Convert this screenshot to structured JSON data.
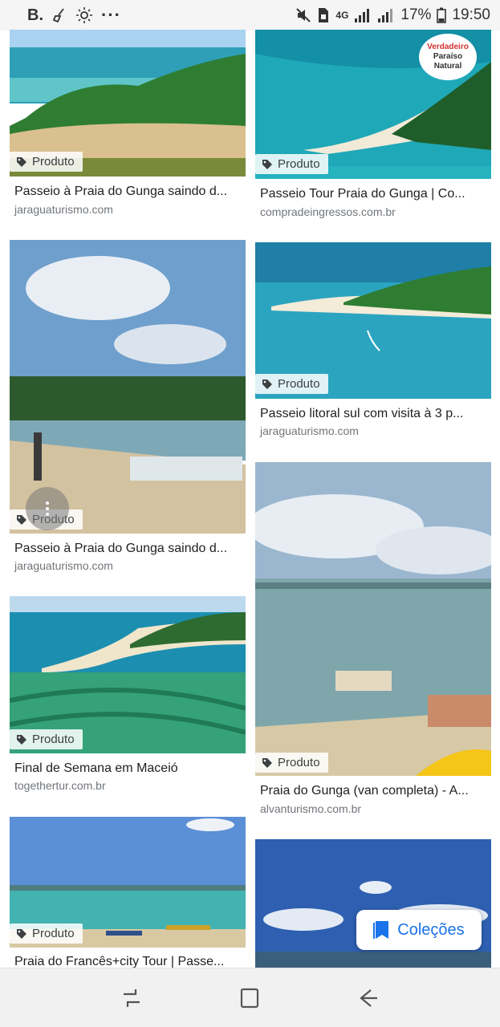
{
  "status_bar": {
    "left_label": "B.",
    "left_dots": "···",
    "network": "4G",
    "battery": "17%",
    "time": "19:50"
  },
  "badge_label": "Produto",
  "cards": [
    {
      "title": "Passeio à Praia do Gunga saindo d...",
      "source": "jaraguaturismo.com"
    },
    {
      "title": "Passeio Tour Praia do Gunga | Co...",
      "source": "compradeingressos.com.br",
      "image_overlay": {
        "line1": "Verdadeiro",
        "line2": "Paraíso",
        "line3": "Natural"
      }
    },
    {
      "title": "Passeio à Praia do Gunga saindo d...",
      "source": "jaraguaturismo.com"
    },
    {
      "title": "Passeio litoral sul com visita à 3 p...",
      "source": "jaraguaturismo.com"
    },
    {
      "title": "Final de Semana em Maceió",
      "source": "togethertur.com.br"
    },
    {
      "title": "Praia do Gunga (van completa) - A...",
      "source": "alvanturismo.com.br"
    },
    {
      "title": "Praia do Francês+city Tour | Passe...",
      "source": ""
    }
  ],
  "collections_button": {
    "label": "Coleções"
  },
  "icons": {
    "tag": "tag-icon",
    "bookmark": "bookmark-icon",
    "recents": "recents-icon",
    "home": "home-icon",
    "back": "back-icon"
  },
  "colors": {
    "accent": "#1a73e8",
    "title_text": "#202124",
    "source_text": "#70757a",
    "status_bar_bg": "#f5f5f5",
    "nav_bar_bg": "#f1f1f1"
  }
}
